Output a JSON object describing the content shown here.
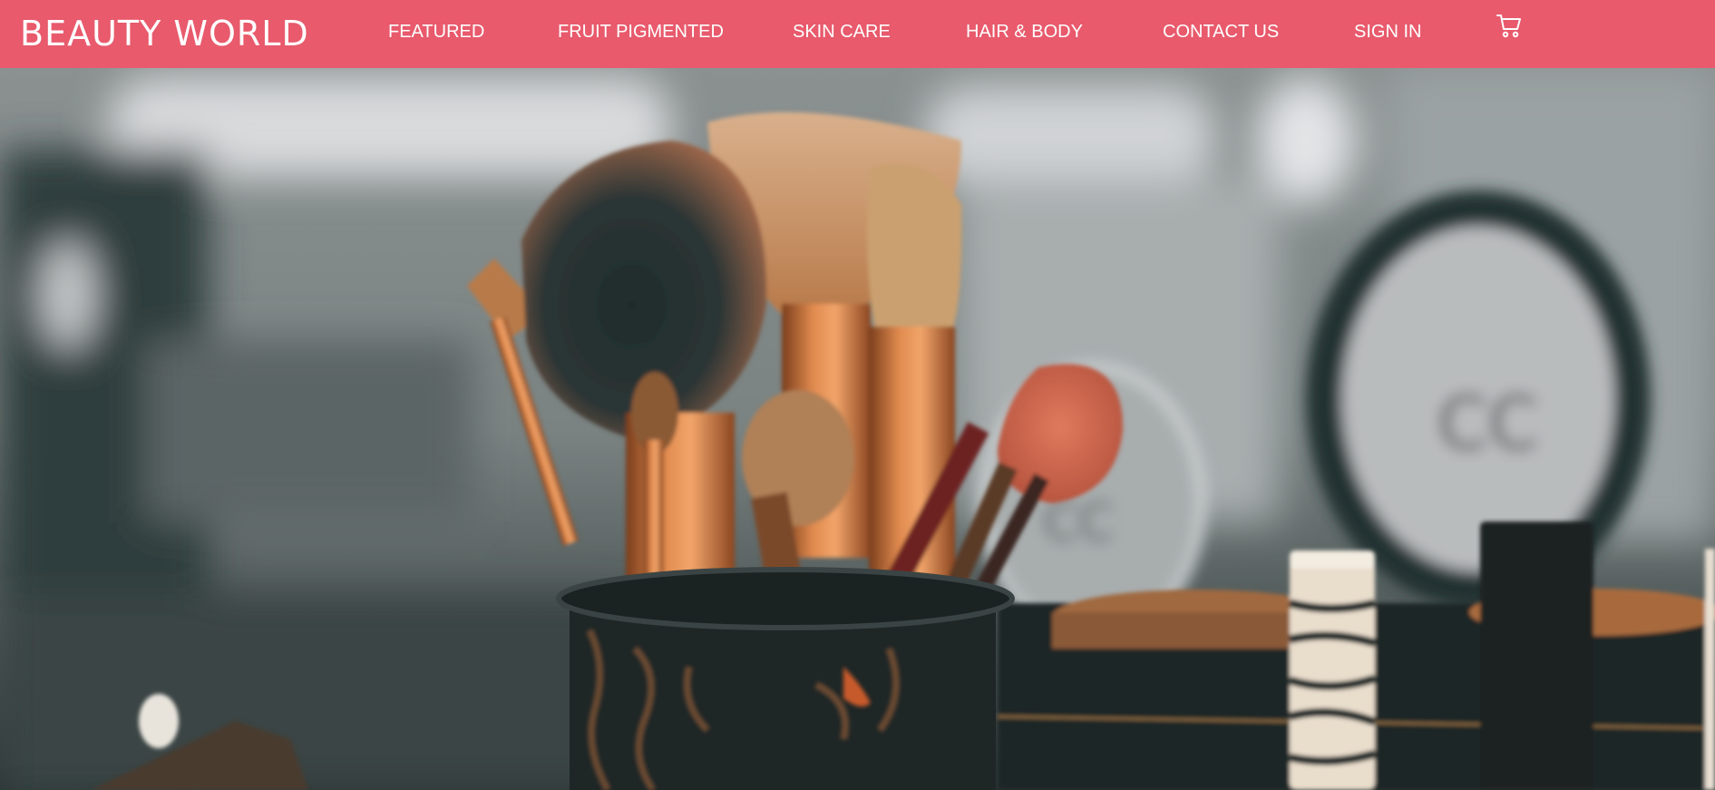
{
  "brand": "BEAUTY WORLD",
  "nav": {
    "items": [
      {
        "label": "FEATURED"
      },
      {
        "label": "FRUIT PIGMENTED"
      },
      {
        "label": "SKIN CARE"
      },
      {
        "label": "HAIR & BODY"
      },
      {
        "label": "CONTACT US"
      },
      {
        "label": "SIGN IN"
      }
    ],
    "cart_icon": "shopping-cart-icon"
  },
  "hero": {
    "image": "makeup-brushes-photo"
  },
  "colors": {
    "navbar_bg": "#e85a6c",
    "nav_text": "#ffffff"
  }
}
